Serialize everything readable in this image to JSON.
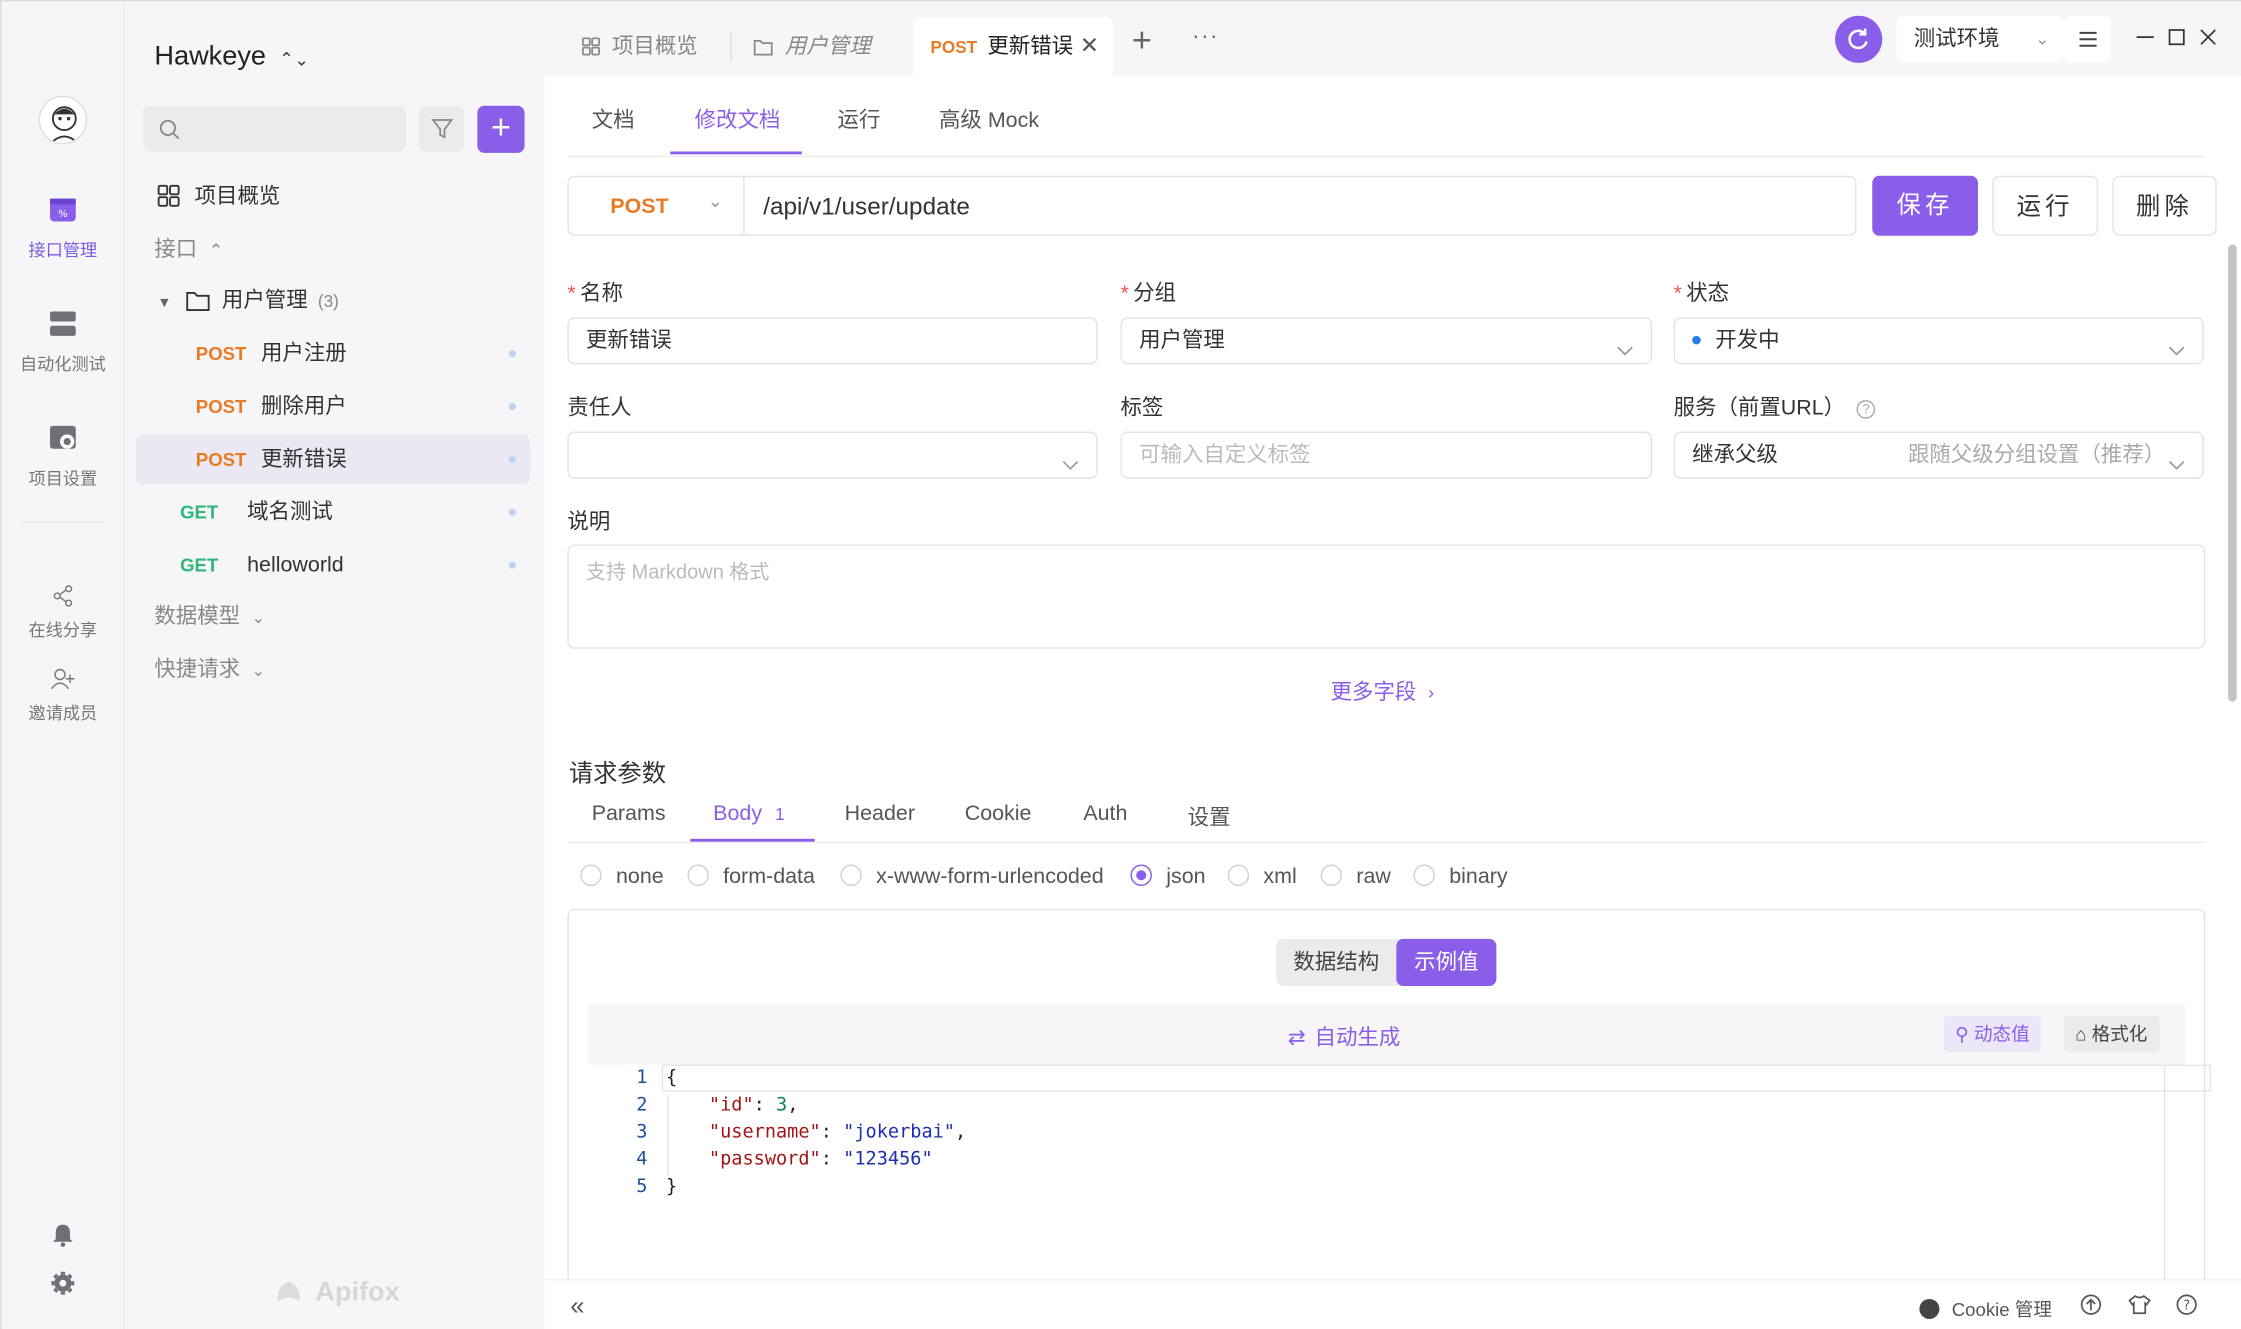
{
  "project": {
    "name": "Hawkeye"
  },
  "rail": {
    "items": [
      {
        "label": "接口管理",
        "icon": "api-manage-icon",
        "active": true
      },
      {
        "label": "自动化测试",
        "icon": "automation-icon"
      },
      {
        "label": "项目设置",
        "icon": "project-settings-icon"
      },
      {
        "label": "在线分享",
        "icon": "share-icon"
      },
      {
        "label": "邀请成员",
        "icon": "invite-member-icon"
      }
    ]
  },
  "sidebar": {
    "overview": "项目概览",
    "interfaces_label": "接口",
    "folder": {
      "name": "用户管理",
      "count": "(3)"
    },
    "endpoints": [
      {
        "method": "POST",
        "name": "用户注册"
      },
      {
        "method": "POST",
        "name": "删除用户"
      },
      {
        "method": "POST",
        "name": "更新错误",
        "selected": true
      },
      {
        "method": "GET",
        "name": "域名测试"
      },
      {
        "method": "GET",
        "name": "helloworld"
      }
    ],
    "data_models": "数据模型",
    "quick_requests": "快捷请求",
    "brand": "Apifox"
  },
  "tabs": [
    {
      "label": "项目概览"
    },
    {
      "label": "用户管理"
    },
    {
      "method": "POST",
      "label": "更新错误",
      "active": true
    }
  ],
  "env": {
    "selected": "测试环境"
  },
  "subtabs": [
    "文档",
    "修改文档",
    "运行",
    "高级 Mock"
  ],
  "request": {
    "method": "POST",
    "url": "/api/v1/user/update",
    "save": "保存",
    "run": "运行",
    "delete": "删除"
  },
  "form": {
    "name_label": "名称",
    "name_value": "更新错误",
    "group_label": "分组",
    "group_value": "用户管理",
    "status_label": "状态",
    "status_value": "开发中",
    "owner_label": "责任人",
    "tags_label": "标签",
    "tags_placeholder": "可输入自定义标签",
    "service_label": "服务（前置URL）",
    "service_value": "继承父级",
    "service_hint": "跟随父级分组设置（推荐）",
    "desc_label": "说明",
    "desc_placeholder": "支持 Markdown 格式",
    "more_fields": "更多字段"
  },
  "params": {
    "section_title": "请求参数",
    "tabs": [
      "Params",
      "Body",
      "Header",
      "Cookie",
      "Auth",
      "设置"
    ],
    "body_count": "1",
    "body_types": [
      "none",
      "form-data",
      "x-www-form-urlencoded",
      "json",
      "xml",
      "raw",
      "binary"
    ],
    "selected_body_type": "json",
    "view_toggle": [
      "数据结构",
      "示例值"
    ],
    "auto_generate": "自动生成",
    "dynamic_value": "动态值",
    "format": "格式化"
  },
  "code": {
    "line_numbers": [
      "1",
      "2",
      "3",
      "4",
      "5"
    ],
    "open": "{",
    "close": "}",
    "id_key": "\"id\"",
    "id_value": "3",
    "username_key": "\"username\"",
    "username_value": "\"jokerbai\"",
    "password_key": "\"password\"",
    "password_value": "\"123456\""
  },
  "statusbar": {
    "cookie": "Cookie 管理"
  },
  "colors": {
    "accent": "#8a5ee8",
    "post": "#e97b25",
    "get": "#2fb679"
  }
}
